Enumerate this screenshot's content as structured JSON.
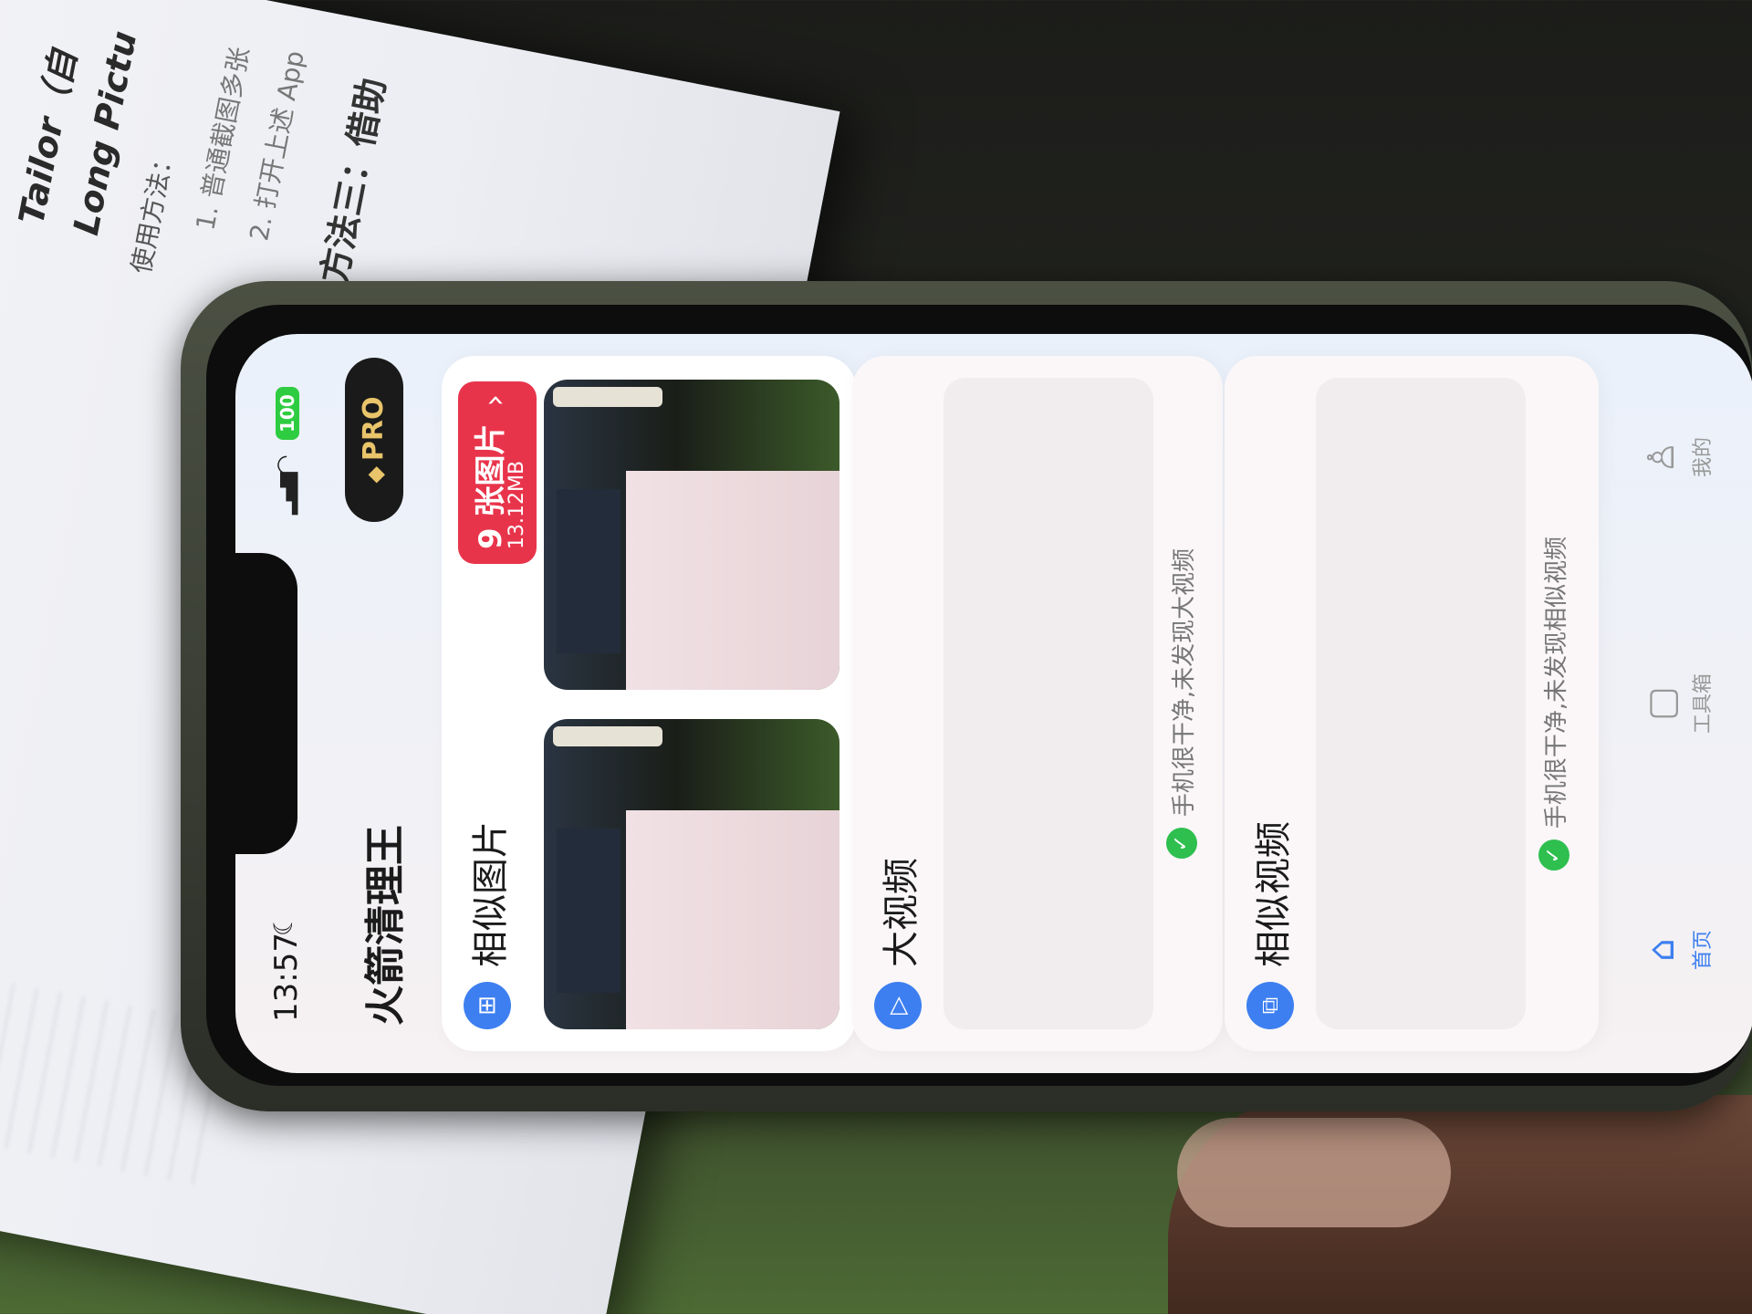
{
  "background_doc": {
    "line1": "Tailor（自",
    "line2": "Long Pictu",
    "line3": "使用方法：",
    "line4": "1. 普通截图多张",
    "line5": "2. 打开上述 App",
    "line6": "方法三：借助"
  },
  "status": {
    "time": "13:57",
    "battery": "100"
  },
  "header": {
    "app_title": "火箭清理王",
    "pro_label": "PRO"
  },
  "similar_photos": {
    "title": "相似图片",
    "count_label": "9 张图片",
    "size_label": "13.12MB"
  },
  "big_videos": {
    "title": "大视频",
    "status_message": "手机很干净,未发现大视频"
  },
  "similar_videos": {
    "title": "相似视频",
    "status_message": "手机很干净,未发现相似视频"
  },
  "tabbar": {
    "items": [
      {
        "label": "首页",
        "icon": "home-icon"
      },
      {
        "label": "工具箱",
        "icon": "toolbox-icon"
      },
      {
        "label": "我的",
        "icon": "profile-icon"
      }
    ]
  },
  "colors": {
    "accent": "#3d7ff0",
    "badge": "#e8344b",
    "success": "#2ebf4f"
  }
}
